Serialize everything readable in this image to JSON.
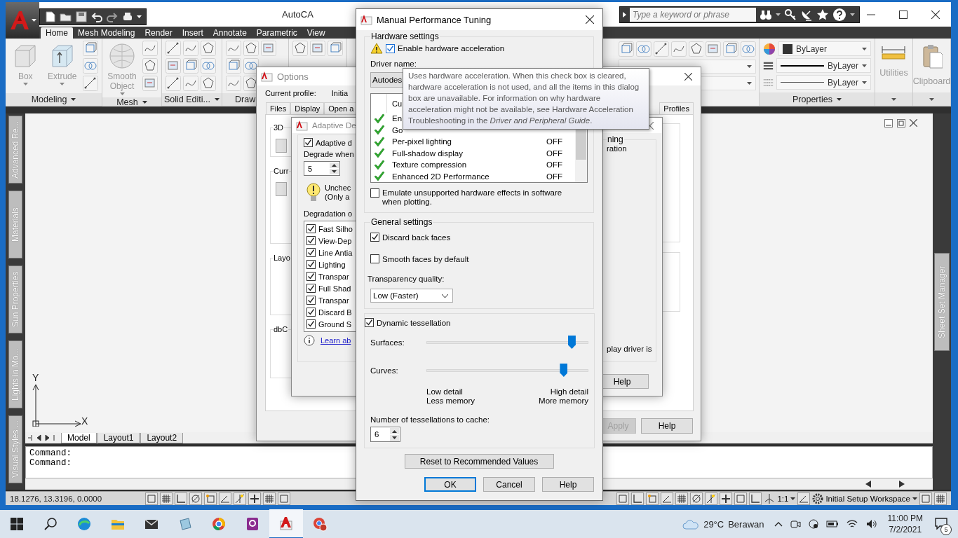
{
  "app_window": {
    "title": "AutoCA",
    "search": {
      "placeholder": "Type a keyword or phrase"
    }
  },
  "ribbon": {
    "tabs": [
      {
        "label": "Home",
        "selected": true
      },
      {
        "label": "Mesh Modeling",
        "selected": false
      },
      {
        "label": "Render",
        "selected": false
      },
      {
        "label": "Insert",
        "selected": false
      },
      {
        "label": "Annotate",
        "selected": false
      },
      {
        "label": "Parametric",
        "selected": false
      },
      {
        "label": "View",
        "selected": false
      }
    ],
    "panels": [
      {
        "title": "Modeling",
        "kind": "big",
        "buttons": [
          {
            "label": "Box",
            "disabled": true
          },
          {
            "label": "Extrude",
            "disabled": true
          }
        ]
      },
      {
        "title": "Mesh",
        "kind": "big",
        "buttons": [
          {
            "label": "Smooth Object",
            "disabled": true
          }
        ]
      },
      {
        "title": "Solid Editi...",
        "kind": "grid"
      },
      {
        "title": "Draw",
        "kind": "grid"
      },
      {
        "kind": "grid"
      }
    ],
    "properties": {
      "title": "Properties",
      "color_setting": "ByLayer",
      "lineweight_setting": "ByLayer",
      "linetype_setting": "ByLayer"
    },
    "utilities": {
      "label": "Utilities",
      "disabled": true
    },
    "clipboard": {
      "label": "Clipboard",
      "disabled": true
    }
  },
  "palettes": {
    "left": [
      "Advanced Re...",
      "Materials",
      "Sun Properties",
      "Lights in Mo...",
      "Visual Styles ..."
    ],
    "right": [
      "Sheet Set Manager"
    ]
  },
  "canvas": {
    "axis_y": "Y",
    "axis_x": "X"
  },
  "layout_tabs": [
    {
      "label": "Model",
      "selected": true
    },
    {
      "label": "Layout1",
      "selected": false
    },
    {
      "label": "Layout2",
      "selected": false
    }
  ],
  "command_lines": [
    "Command:",
    "Command:"
  ],
  "status_bar": {
    "coordinates": "18.1276, 13.3196, 0.0000",
    "scale": "1:1",
    "workspace": "Initial Setup Workspace"
  },
  "options_dialog": {
    "title": "Options",
    "profile_label": "Current profile:",
    "profile_value": "Initia",
    "tabs": [
      {
        "label": "Files",
        "selected": false
      },
      {
        "label": "Display",
        "selected": false
      },
      {
        "label": "Open a",
        "selected": false
      },
      {
        "label": "Profiles",
        "selected": false
      }
    ],
    "groups": [
      "3D",
      "Curr",
      "Layo",
      "dbC"
    ],
    "buttons": [
      {
        "label": "Apply",
        "disabled": true
      },
      {
        "label": "Help",
        "disabled": false
      }
    ]
  },
  "adaptive_dialog": {
    "title": "Adaptive De",
    "enable_label": "Adaptive d",
    "enable_checked": true,
    "degrade_label": "Degrade when",
    "degrade_value": "5",
    "note": [
      "Unchec",
      "(Only a"
    ],
    "list_label": "Degradation o",
    "features": [
      {
        "label": "Fast Silho",
        "checked": true
      },
      {
        "label": "View-Dep",
        "checked": true
      },
      {
        "label": "Line Antia",
        "checked": true
      },
      {
        "label": "Lighting",
        "checked": true
      },
      {
        "label": "Transpar",
        "checked": true
      },
      {
        "label": "Full Shad",
        "checked": true
      },
      {
        "label": "Transpar",
        "checked": true
      },
      {
        "label": "Discard B",
        "checked": true
      },
      {
        "label": "Ground S",
        "checked": true
      }
    ],
    "link": "Learn ab",
    "group_title": "ning",
    "right_texts": [
      "ration",
      "play driver is"
    ],
    "help": "Help"
  },
  "performance_dialog": {
    "title": "Manual Performance Tuning",
    "hardware": {
      "title": "Hardware settings",
      "enable_label": "Enable hardware acceleration",
      "enable_checked": true,
      "driver_label": "Driver name:",
      "driver_value": "Autodes",
      "column_header": "Cu",
      "features": [
        {
          "name": "En"
        },
        {
          "name": "Go"
        },
        {
          "name": "Per-pixel lighting",
          "value": "OFF"
        },
        {
          "name": "Full-shadow display",
          "value": "OFF"
        },
        {
          "name": "Texture compression",
          "value": "OFF"
        },
        {
          "name": "Enhanced 2D Performance",
          "value": "OFF"
        }
      ],
      "emulate_label": "Emulate unsupported hardware effects in software when plotting.",
      "emulate_checked": false
    },
    "general": {
      "title": "General settings",
      "discard_label": "Discard back faces",
      "discard_checked": true,
      "smooth_label": "Smooth faces by default",
      "smooth_checked": false,
      "transparency_label": "Transparency quality:",
      "transparency_value": "Low (Faster)"
    },
    "tessellation": {
      "label": "Dynamic tessellation",
      "checked": true,
      "sliders": [
        {
          "label": "Surfaces:",
          "level": 0.9
        },
        {
          "label": "Curves:",
          "level": 0.85
        }
      ],
      "low": [
        "Low detail",
        "Less memory"
      ],
      "high": [
        "High detail",
        "More memory"
      ],
      "cache_label": "Number of tessellations to cache:",
      "cache_value": "6"
    },
    "buttons": {
      "reset": "Reset to Recommended Values",
      "ok": "OK",
      "cancel": "Cancel",
      "help": "Help"
    }
  },
  "tooltip": {
    "text": "Uses hardware acceleration. When this check box is cleared, hardware acceleration is not used, and all the items in this dialog box are unavailable. For information on why hardware acceleration might not be available, see Hardware Acceleration Troubleshooting in the *Driver and Peripheral Guide*."
  },
  "taskbar": {
    "temperature": "29°C",
    "condition": "Berawan",
    "time": "11:00 PM",
    "date": "7/2/2021",
    "notifications": "5"
  }
}
